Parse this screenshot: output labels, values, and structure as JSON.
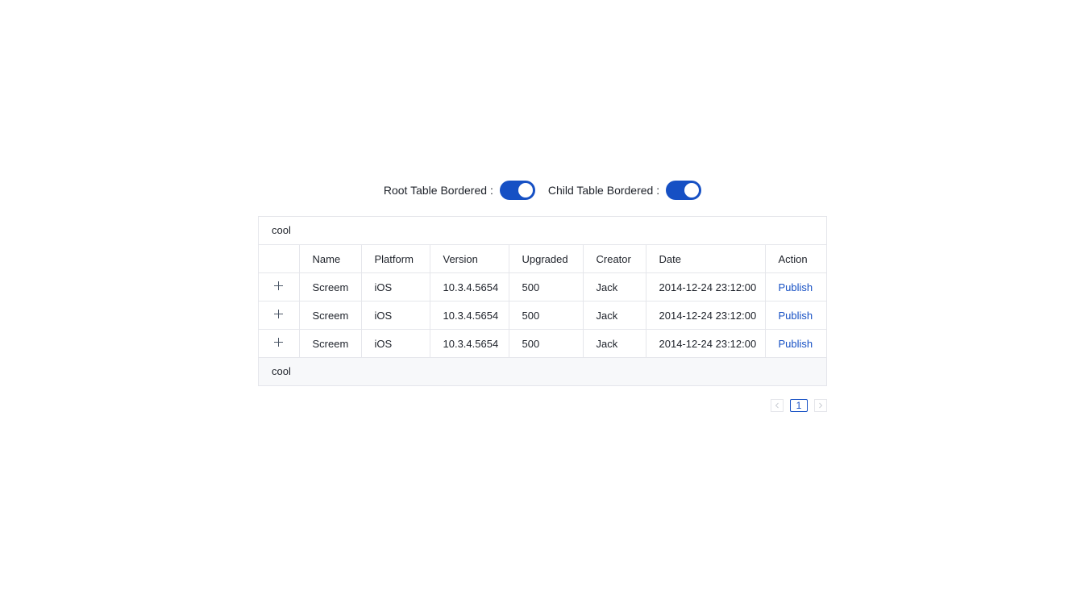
{
  "controls": {
    "root_label": "Root Table Bordered",
    "child_label": "Child Table Bordered",
    "colon": ":",
    "root_on": true,
    "child_on": true
  },
  "table": {
    "title": "cool",
    "footer": "cool",
    "columns": [
      "Name",
      "Platform",
      "Version",
      "Upgraded",
      "Creator",
      "Date",
      "Action"
    ],
    "rows": [
      {
        "name": "Screem",
        "platform": "iOS",
        "version": "10.3.4.5654",
        "upgraded": "500",
        "creator": "Jack",
        "date": "2014-12-24 23:12:00",
        "action": "Publish"
      },
      {
        "name": "Screem",
        "platform": "iOS",
        "version": "10.3.4.5654",
        "upgraded": "500",
        "creator": "Jack",
        "date": "2014-12-24 23:12:00",
        "action": "Publish"
      },
      {
        "name": "Screem",
        "platform": "iOS",
        "version": "10.3.4.5654",
        "upgraded": "500",
        "creator": "Jack",
        "date": "2014-12-24 23:12:00",
        "action": "Publish"
      }
    ]
  },
  "pagination": {
    "current": "1",
    "prev_icon": "chevron-left-icon",
    "next_icon": "chevron-right-icon"
  },
  "colors": {
    "primary": "#1650c4",
    "border": "#e5e6eb",
    "footer_bg": "#f7f8fa"
  }
}
